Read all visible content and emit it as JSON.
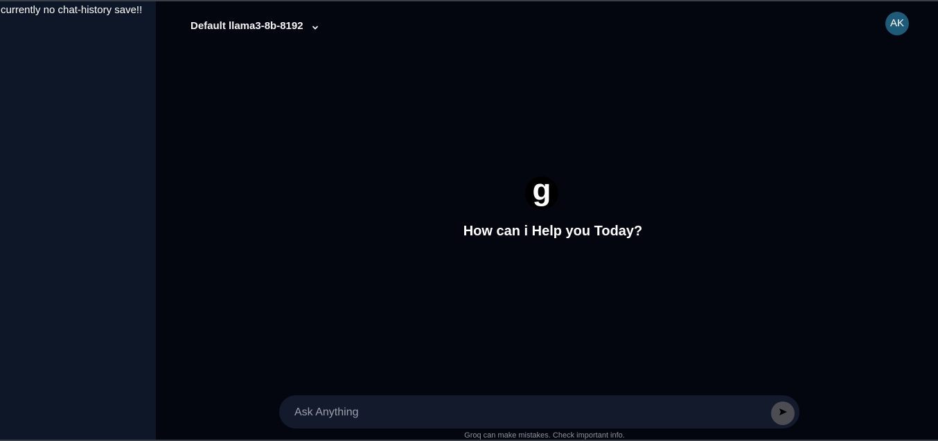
{
  "sidebar": {
    "note": "currently no chat-history save!!"
  },
  "header": {
    "model_label": "Default llama3-8b-8192",
    "chevron_icon": "chevron-down-icon",
    "avatar_initials": "AK",
    "avatar_color": "#1d5b78"
  },
  "hero": {
    "logo_letter": "g",
    "greeting": "How can i Help you Today?"
  },
  "composer": {
    "placeholder": "Ask Anything",
    "value": "",
    "send_icon": "send-icon"
  },
  "footer": {
    "disclaimer": "Groq can make mistakes. Check important info."
  },
  "colors": {
    "background": "#03060f",
    "sidebar": "#0e1727",
    "composer": "#121a2b",
    "send_button": "#4b4d52"
  }
}
